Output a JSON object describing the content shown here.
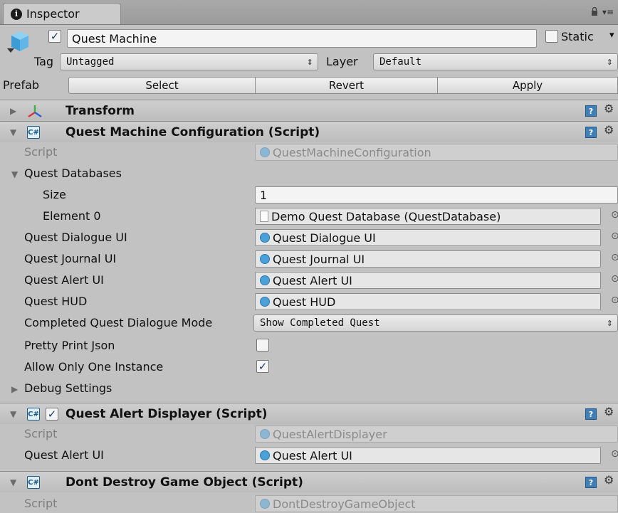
{
  "window": {
    "tab_title": "Inspector",
    "lock_icon": "lock-icon",
    "menu_icon": "context-menu-icon"
  },
  "gameobject": {
    "name": "Quest Machine",
    "active": true,
    "static_label": "Static",
    "tag_label": "Tag",
    "tag_value": "Untagged",
    "layer_label": "Layer",
    "layer_value": "Default",
    "prefab_label": "Prefab",
    "prefab_buttons": [
      "Select",
      "Revert",
      "Apply"
    ]
  },
  "components": {
    "transform": {
      "title": "Transform"
    },
    "config": {
      "title": "Quest Machine Configuration (Script)",
      "script_label": "Script",
      "script_value": "QuestMachineConfiguration",
      "databases_label": "Quest Databases",
      "size_label": "Size",
      "size_value": "1",
      "element0_label": "Element 0",
      "element0_value": "Demo Quest Database (QuestDatabase)",
      "dialogue_ui_label": "Quest Dialogue UI",
      "dialogue_ui_value": "Quest Dialogue UI",
      "journal_ui_label": "Quest Journal UI",
      "journal_ui_value": "Quest Journal UI",
      "alert_ui_label": "Quest Alert UI",
      "alert_ui_value": "Quest Alert UI",
      "hud_label": "Quest HUD",
      "hud_value": "Quest HUD",
      "completed_mode_label": "Completed Quest Dialogue Mode",
      "completed_mode_value": "Show Completed Quest",
      "pretty_print_label": "Pretty Print Json",
      "pretty_print": false,
      "one_instance_label": "Allow Only One Instance",
      "one_instance": true,
      "debug_label": "Debug Settings"
    },
    "alert_displayer": {
      "title": "Quest Alert Displayer (Script)",
      "enabled": true,
      "script_label": "Script",
      "script_value": "QuestAlertDisplayer",
      "alert_ui_label": "Quest Alert UI",
      "alert_ui_value": "Quest Alert UI"
    },
    "dont_destroy": {
      "title": "Dont Destroy Game Object (Script)",
      "script_label": "Script",
      "script_value": "DontDestroyGameObject"
    }
  },
  "glyphs": {
    "check": "✓",
    "fold_open": "▼",
    "fold_closed": "▶",
    "gear": "⚙",
    "help": "?",
    "obj_picker": "⊙",
    "popup_arrows": "⇕",
    "script_cs": "C#",
    "info": "i",
    "menu_arrows": "▾≡",
    "static_arrow": "▾"
  }
}
